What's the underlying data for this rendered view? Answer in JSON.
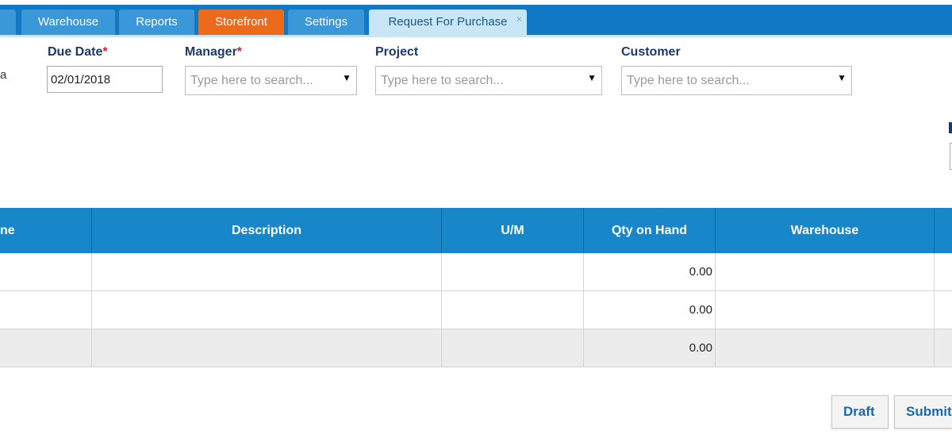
{
  "tabs": [
    {
      "label": "",
      "style": "normal"
    },
    {
      "label": "Warehouse",
      "style": "normal"
    },
    {
      "label": "Reports",
      "style": "normal"
    },
    {
      "label": "Storefront",
      "style": "orange"
    },
    {
      "label": "Settings",
      "style": "normal"
    },
    {
      "label": "Request For Purchase",
      "style": "active",
      "close": "×"
    }
  ],
  "form": {
    "partial_left_text": "a",
    "due_date": {
      "label": "Due Date",
      "required_mark": "*",
      "value": "02/01/2018"
    },
    "manager": {
      "label": "Manager",
      "required_mark": "*",
      "placeholder": "Type here to search..."
    },
    "project": {
      "label": "Project",
      "placeholder": "Type here to search..."
    },
    "customer": {
      "label": "Customer",
      "placeholder": "Type here to search..."
    },
    "dropdown_arrow": "▼"
  },
  "grid": {
    "columns": [
      "ne",
      "Description",
      "U/M",
      "Qty on Hand",
      "Warehouse",
      ""
    ],
    "rows": [
      {
        "qty_on_hand": "0.00"
      },
      {
        "qty_on_hand": "0.00"
      },
      {
        "qty_on_hand": "0.00"
      }
    ]
  },
  "actions": {
    "draft": "Draft",
    "submit": "Submit"
  },
  "colors": {
    "header_blue": "#1179c3",
    "grid_header": "#1887ca",
    "orange_tab": "#eb6a1b",
    "label_navy": "#1a3a69"
  }
}
